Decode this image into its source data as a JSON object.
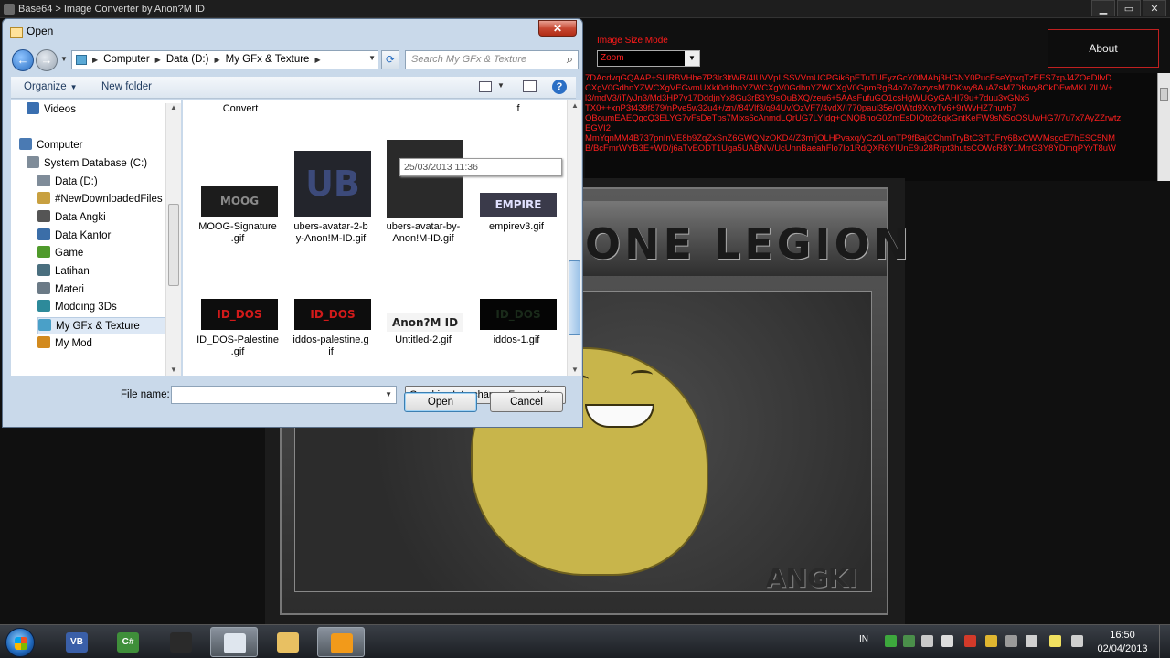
{
  "app": {
    "title": "Base64 > Image Converter by Anon?M ID",
    "controls": {
      "minimize": "▁",
      "maximize": "▭",
      "close": "✕"
    },
    "size_mode": {
      "label": "Image Size Mode",
      "value": "Zoom"
    },
    "about_label": "About",
    "base64_lines": [
      "7DAcdvqGQAAP+SURBVHhe7P3lr3ltWR/4IUVVpLSSVVmUCPGik6pETuTUEyzGcY0fMAbj3HGNY0PucEseYpxqTzEES7xpJ4ZOeDllvD",
      "CXgV0GdhnYZWCXgVEGvmUXkl0ddhnYZWCXgV0GdhnYZWCXgV0GpmRgB4o7o7ozyrsM7DKwy8AuA7sM7DKwy8CkDFwMKL7lLW+",
      "l3/mdV3/iT/yJn3/Md3HP7v17DddjnYx8Gu3rB3Y9sOuBXQ/zeu6+5AAsFufuGO1csHgWUGyGAHI79u+7duu3vGNx5",
      "TX0++xnP3t439f879/nPve5w32u4+/zn//84Vlf3/q94Uv/OzVF7/4vdX/I770paul35e/OWtd9XvvTv6+9rWvHZ7nuvb7",
      "",
      "OBoumEAEQgcQ3ELYG7vFsDeTps7Mixs6cAnmdLQrUG7LYIdg+ONQBnoG0ZmEsDIQtg26qkGntKeFW9sNSoOSUwHG7/7u7x7AyZZrwtz",
      "EGVI2",
      "MmYqnMM4B737pnInVE8b9ZqZxSnZ6GWQNzOKD4/Z3mfjOLHPvaxq/yCz0LonTP9fBajCChmTryBtC3fTJFry6BxCWVMsgcE7hESC5NM",
      "",
      "B/BcFmrWYB3E+WD/j6aTvEODT1Uga5UABNV/UcUnnBaeahFlo7lo1RdQXR6YlUnE9u28Rrpt3hutsCOWcR8Y1MrrG3Y8YDmqPYvT8uW"
    ],
    "image": {
      "banner_text": "ONE LEGION",
      "corner_text": "ANGKI"
    }
  },
  "dialog": {
    "title": "Open",
    "close_glyph": "✕",
    "breadcrumbs": [
      "Computer",
      "Data (D:)",
      "My GFx & Texture"
    ],
    "search_placeholder": "Search My GFx & Texture",
    "toolbar": {
      "organize": "Organize",
      "new_folder": "New folder",
      "help": "?"
    },
    "nav_items": [
      {
        "label": "Videos",
        "icon": "video-icon",
        "color": "#3a6fb0"
      },
      {
        "label": "Computer",
        "icon": "computer-icon",
        "color": "#4a7ab3"
      },
      {
        "label": "System Database (C:)",
        "icon": "drive-icon",
        "color": "#7f8c99"
      },
      {
        "label": "Data (D:)",
        "icon": "drive-icon",
        "color": "#7f8c99"
      },
      {
        "label": "#NewDownloadedFiles",
        "icon": "folder-icon",
        "color": "#c8a040"
      },
      {
        "label": "Data Angki",
        "icon": "folder-icon",
        "color": "#555555"
      },
      {
        "label": "Data Kantor",
        "icon": "folder-icon",
        "color": "#3b6ea8"
      },
      {
        "label": "Game",
        "icon": "game-icon",
        "color": "#4f9a2b"
      },
      {
        "label": "Latihan",
        "icon": "folder-icon",
        "color": "#4a6f7f"
      },
      {
        "label": "Materi",
        "icon": "folder-icon",
        "color": "#6b7a86"
      },
      {
        "label": "Modding 3Ds",
        "icon": "folder-icon",
        "color": "#2d8a9a"
      },
      {
        "label": "My GFx & Texture",
        "icon": "folder-icon",
        "color": "#4aa0c8"
      },
      {
        "label": "My Mod",
        "icon": "folder-icon",
        "color": "#d28a1e"
      }
    ],
    "top_labels": [
      "Convert",
      "f"
    ],
    "files": [
      {
        "name": "MOOG-Signature.gif",
        "line1": "MOOG-Signature",
        "line2": ".gif",
        "thumb_text": "MOOG",
        "bg": "#1c1c1c",
        "fg": "#8a8a8a"
      },
      {
        "name": "ubers-avatar-2-by-Anon!M-ID.gif",
        "line1": "ubers-avatar-2-b",
        "line2": "y-Anon!M-ID.gif",
        "thumb_text": "UB",
        "bg": "#23252c",
        "fg": "#3c4a7a"
      },
      {
        "name": "ubers-avatar-by-Anon!M-ID.gif",
        "line1": "ubers-avatar-by-",
        "line2": "Anon!M-ID.gif",
        "thumb_text": "",
        "bg": "#2a2a2a",
        "fg": "#444444"
      },
      {
        "name": "empirev3.gif",
        "line1": "empirev3.gif",
        "line2": "",
        "thumb_text": "EMPIRE",
        "bg": "#3a3a4a",
        "fg": "#e0e0ff"
      },
      {
        "name": "ID_DOS-Palestine.gif",
        "line1": "ID_DOS-Palestine",
        "line2": ".gif",
        "thumb_text": "ID_DOS",
        "bg": "#0d0d0d",
        "fg": "#d11a1a"
      },
      {
        "name": "iddos-palestine.gif",
        "line1": "iddos-palestine.g",
        "line2": "if",
        "thumb_text": "ID_DOS",
        "bg": "#0d0d0d",
        "fg": "#d11a1a"
      },
      {
        "name": "Untitled-2.gif",
        "line1": "Untitled-2.gif",
        "line2": "",
        "thumb_text": "Anon?M ID",
        "bg": "#f4f4f4",
        "fg": "#222222"
      },
      {
        "name": "iddos-1.gif",
        "line1": "iddos-1.gif",
        "line2": "",
        "thumb_text": "ID_DOS",
        "bg": "#050505",
        "fg": "#1a2a1a"
      }
    ],
    "tooltip": "25/03/2013 11:36",
    "file_name_label": "File name:",
    "file_name_value": "",
    "filter_value": "Graphics Interchange Format (*",
    "open_label": "Open",
    "cancel_label": "Cancel"
  },
  "taskbar": {
    "apps": [
      {
        "icon": "vb-icon",
        "glyph": "VB",
        "color": "#3a5fa8",
        "active": false
      },
      {
        "icon": "csharp-icon",
        "glyph": "C#",
        "color": "#3f8f3a",
        "active": false
      },
      {
        "icon": "shield-icon",
        "glyph": "",
        "color": "#2a2a2a",
        "active": false
      },
      {
        "icon": "converter-icon",
        "glyph": "",
        "color": "#dfe6ee",
        "active": true
      },
      {
        "icon": "explorer-icon",
        "glyph": "",
        "color": "#e8c062",
        "active": false
      },
      {
        "icon": "media-icon",
        "glyph": "",
        "color": "#f29a1a",
        "active": true
      }
    ],
    "language": "IN",
    "time": "16:50",
    "date": "02/04/2013"
  }
}
